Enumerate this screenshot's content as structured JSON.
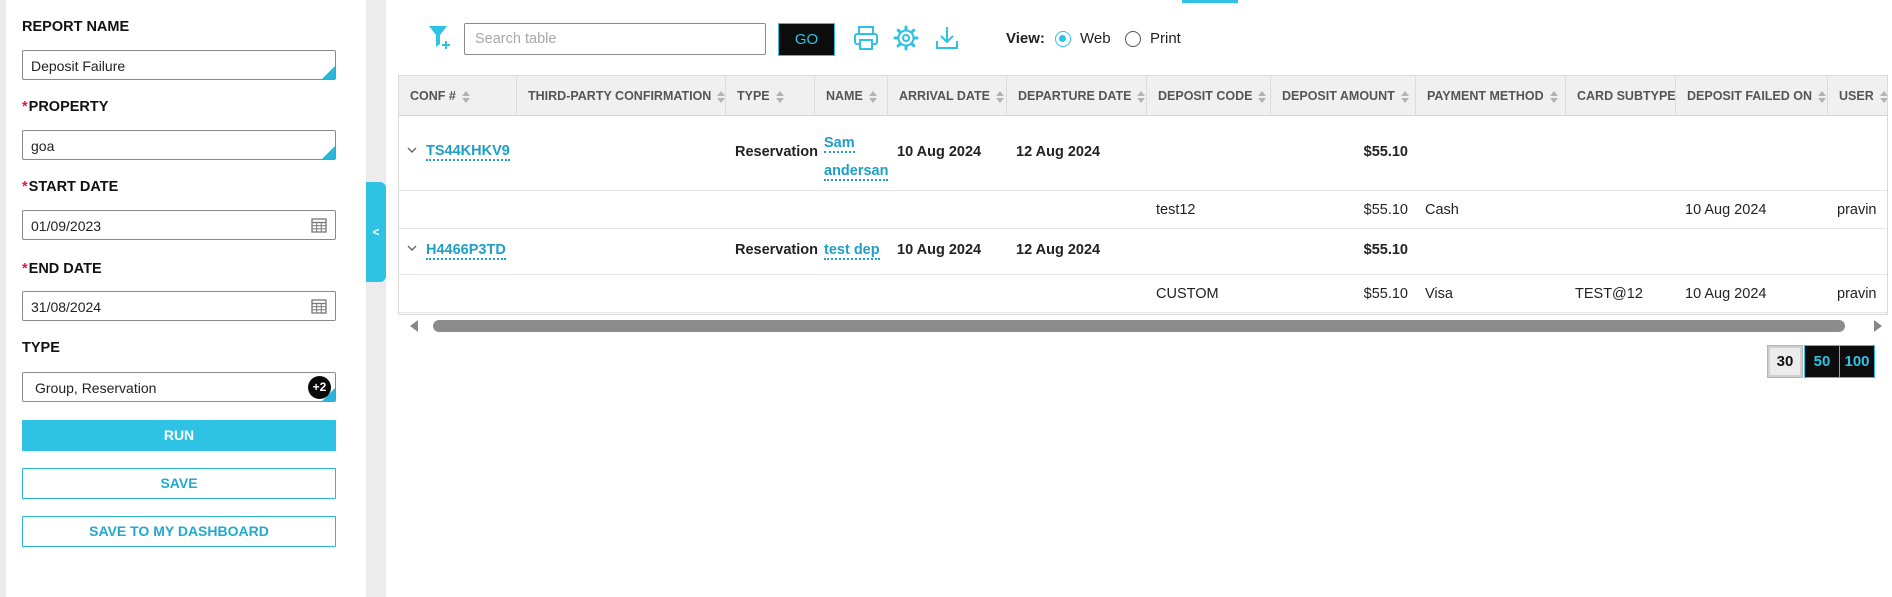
{
  "sidebar": {
    "report_name": {
      "label": "REPORT NAME",
      "value": "Deposit Failure"
    },
    "property": {
      "required_mark": "*",
      "label": "PROPERTY",
      "value": "goa"
    },
    "start_date": {
      "required_mark": "*",
      "label": "START DATE",
      "value": "01/09/2023"
    },
    "end_date": {
      "required_mark": "*",
      "label": "END DATE",
      "value": "31/08/2024"
    },
    "type": {
      "label": "TYPE",
      "value": "Group, Reservation",
      "extra_badge": "+2"
    },
    "run_label": "RUN",
    "save_label": "SAVE",
    "save_dashboard_label": "SAVE TO MY DASHBOARD",
    "collapse_glyph": "<"
  },
  "toolbar": {
    "search_placeholder": "Search table",
    "go_label": "GO",
    "view_label": "View:",
    "view_options": [
      {
        "label": "Web",
        "selected": true
      },
      {
        "label": "Print",
        "selected": false
      }
    ],
    "icons": [
      "filter-add-icon",
      "printer-icon",
      "gear-icon",
      "download-icon"
    ]
  },
  "table": {
    "columns": [
      "CONF #",
      "THIRD-PARTY CONFIRMATION",
      "TYPE",
      "NAME",
      "ARRIVAL DATE",
      "DEPARTURE DATE",
      "DEPOSIT CODE",
      "DEPOSIT AMOUNT",
      "PAYMENT METHOD",
      "CARD SUBTYPE",
      "DEPOSIT FAILED ON",
      "USER"
    ],
    "groups": [
      {
        "conf": "TS44KHKV9",
        "type": "Reservation",
        "name_line1": "Sam",
        "name_line2": "andersan",
        "arrival": "10 Aug 2024",
        "departure": "12 Aug 2024",
        "amount": "$55.10",
        "detail": {
          "deposit_code": "test12",
          "amount": "$55.10",
          "payment_method": "Cash",
          "card_subtype": "",
          "failed_on": "10 Aug 2024",
          "user": "pravin"
        }
      },
      {
        "conf": "H4466P3TD",
        "type": "Reservation",
        "name_line1": "test dep",
        "name_line2": "",
        "arrival": "10 Aug 2024",
        "departure": "12 Aug 2024",
        "amount": "$55.10",
        "detail": {
          "deposit_code": "CUSTOM",
          "amount": "$55.10",
          "payment_method": "Visa",
          "card_subtype": "TEST@12",
          "failed_on": "10 Aug 2024",
          "user": "pravin"
        }
      }
    ]
  },
  "pagination": {
    "sizes": [
      "30",
      "50",
      "100"
    ],
    "selected": "30"
  },
  "colors": {
    "accent": "#2ec2e5",
    "link": "#1d9fc6",
    "required": "#e0193a",
    "dark_button": "#0c0c0c"
  }
}
